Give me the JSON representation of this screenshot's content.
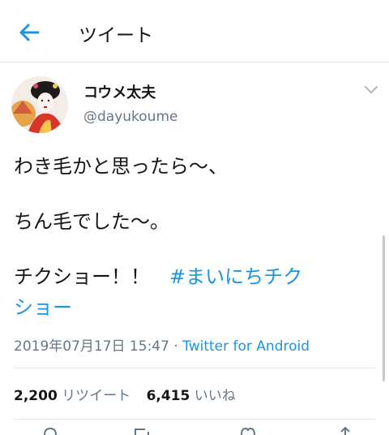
{
  "header": {
    "title": "ツイート",
    "back_icon": "arrow-left-icon"
  },
  "tweet": {
    "display_name": "コウメ太夫",
    "handle": "@dayukoume",
    "lines": [
      "わき毛かと思ったら〜、",
      "ちん毛でした〜。"
    ],
    "line3_text": "チクショー！！　",
    "hashtag_line1": "#まいにちチク",
    "hashtag_line2": "ショー",
    "date": "2019年07月17日 15:47 · ",
    "source": "Twitter for Android"
  },
  "stats": {
    "retweets_count": "2,200",
    "retweets_label": " リツイート ",
    "likes_count": "6,415",
    "likes_label": " いいね"
  },
  "colors": {
    "accent": "#1b95e0",
    "text": "#14171a",
    "secondary": "#657786",
    "divider": "#e1e8ed"
  }
}
